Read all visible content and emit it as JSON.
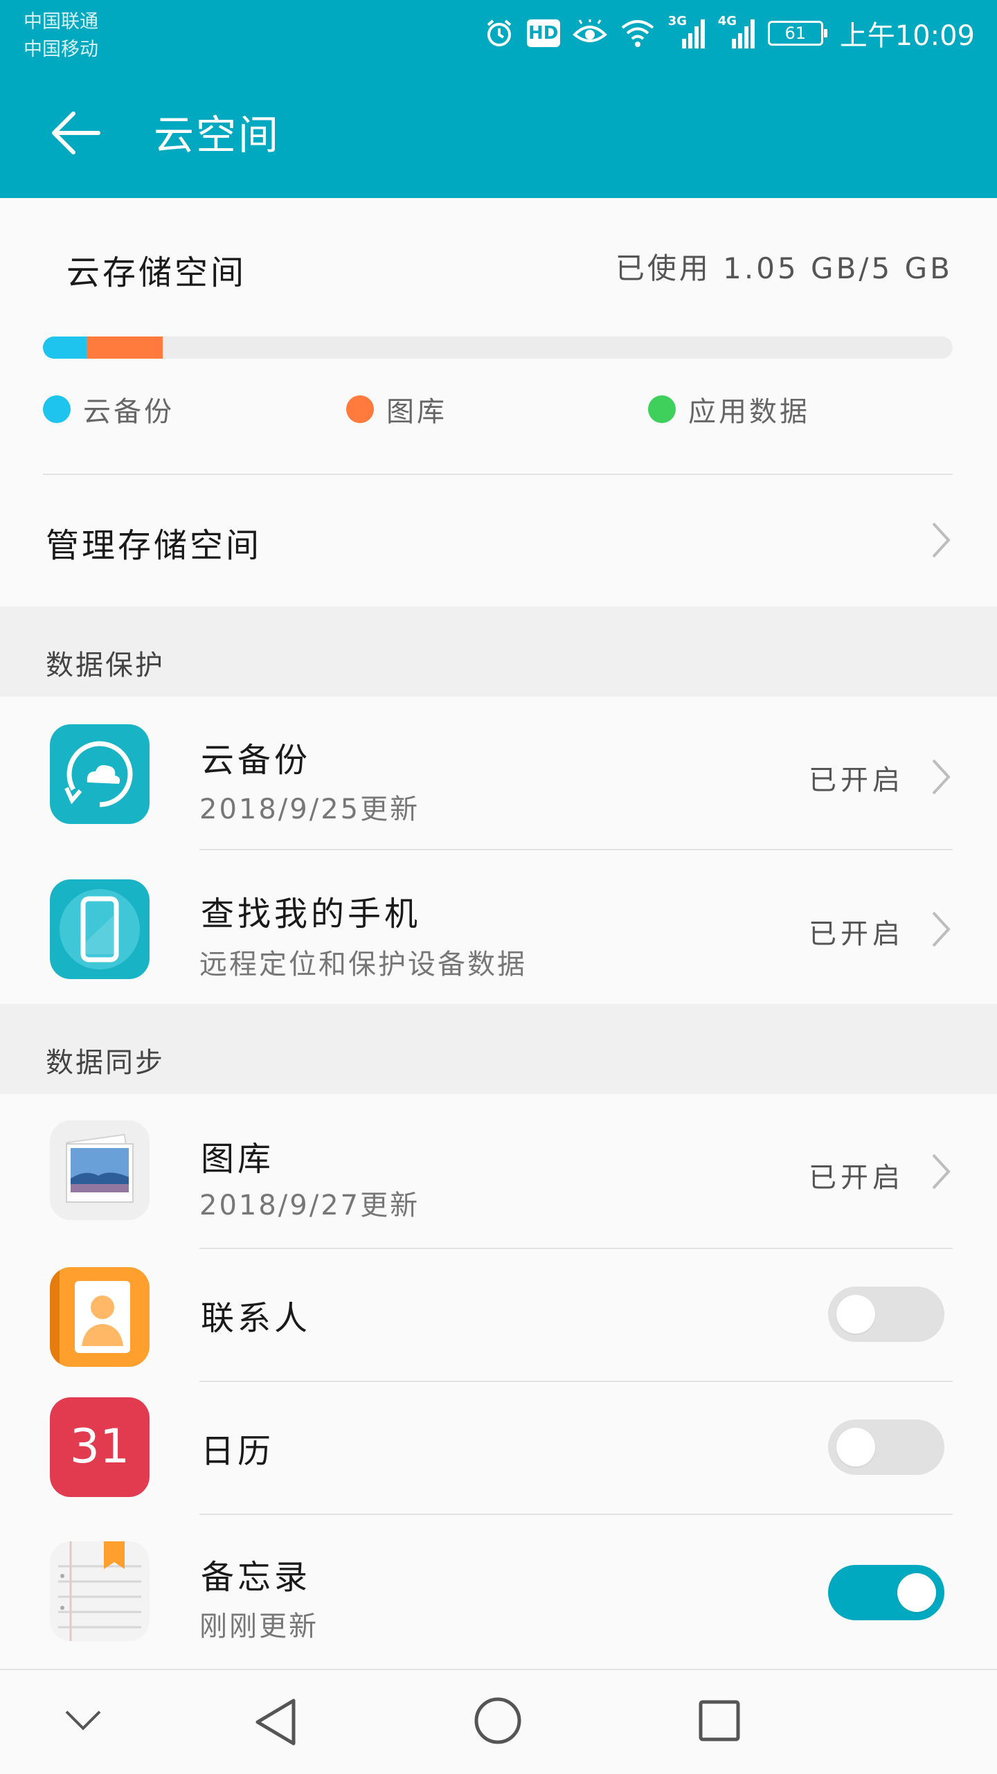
{
  "status_bar": {
    "carrier_1": "中国联通",
    "carrier_2": "中国移动",
    "network_1": "3G",
    "network_2": "4G",
    "hd_label": "HD",
    "battery": "61",
    "time": "上午10:09",
    "icons": [
      "alarm-icon",
      "hd-icon",
      "eye-comfort-icon",
      "wifi-icon",
      "signal-icon",
      "battery-icon"
    ]
  },
  "app_bar": {
    "title": "云空间",
    "back_icon": "arrow-left-icon"
  },
  "storage": {
    "title": "云存储空间",
    "used_text": "已使用 1.05 GB/5 GB",
    "progress": {
      "cloud_backup_fraction": 0.048,
      "gallery_fraction": 0.084,
      "app_data_fraction": 0.0
    },
    "legend": [
      {
        "label": "云备份",
        "color": "#1ec3ee"
      },
      {
        "label": "图库",
        "color": "#ff7a3c"
      },
      {
        "label": "应用数据",
        "color": "#3fcf5b"
      }
    ],
    "manage_label": "管理存储空间"
  },
  "data_protection": {
    "header": "数据保护",
    "items": [
      {
        "title": "云备份",
        "subtitle": "2018/9/25更新",
        "state": "已开启",
        "icon": "cloud-backup-icon"
      },
      {
        "title": "查找我的手机",
        "subtitle": "远程定位和保护设备数据",
        "state": "已开启",
        "icon": "find-phone-icon"
      }
    ]
  },
  "data_sync": {
    "header": "数据同步",
    "gallery": {
      "title": "图库",
      "subtitle": "2018/9/27更新",
      "state": "已开启",
      "icon": "gallery-icon"
    },
    "contacts": {
      "title": "联系人",
      "enabled": false,
      "icon": "contacts-icon"
    },
    "calendar": {
      "title": "日历",
      "enabled": false,
      "icon": "calendar-icon",
      "icon_text": "31"
    },
    "notes": {
      "title": "备忘录",
      "subtitle": "刚刚更新",
      "enabled": true,
      "icon": "notes-icon"
    }
  },
  "colors": {
    "accent": "#00a9bf",
    "cloud_backup": "#1ec3ee",
    "gallery": "#ff7a3c",
    "app_data": "#3fcf5b"
  },
  "nav_bar": {
    "icons": [
      "chevron-down-icon",
      "back-triangle-icon",
      "home-circle-icon",
      "recents-square-icon"
    ]
  }
}
